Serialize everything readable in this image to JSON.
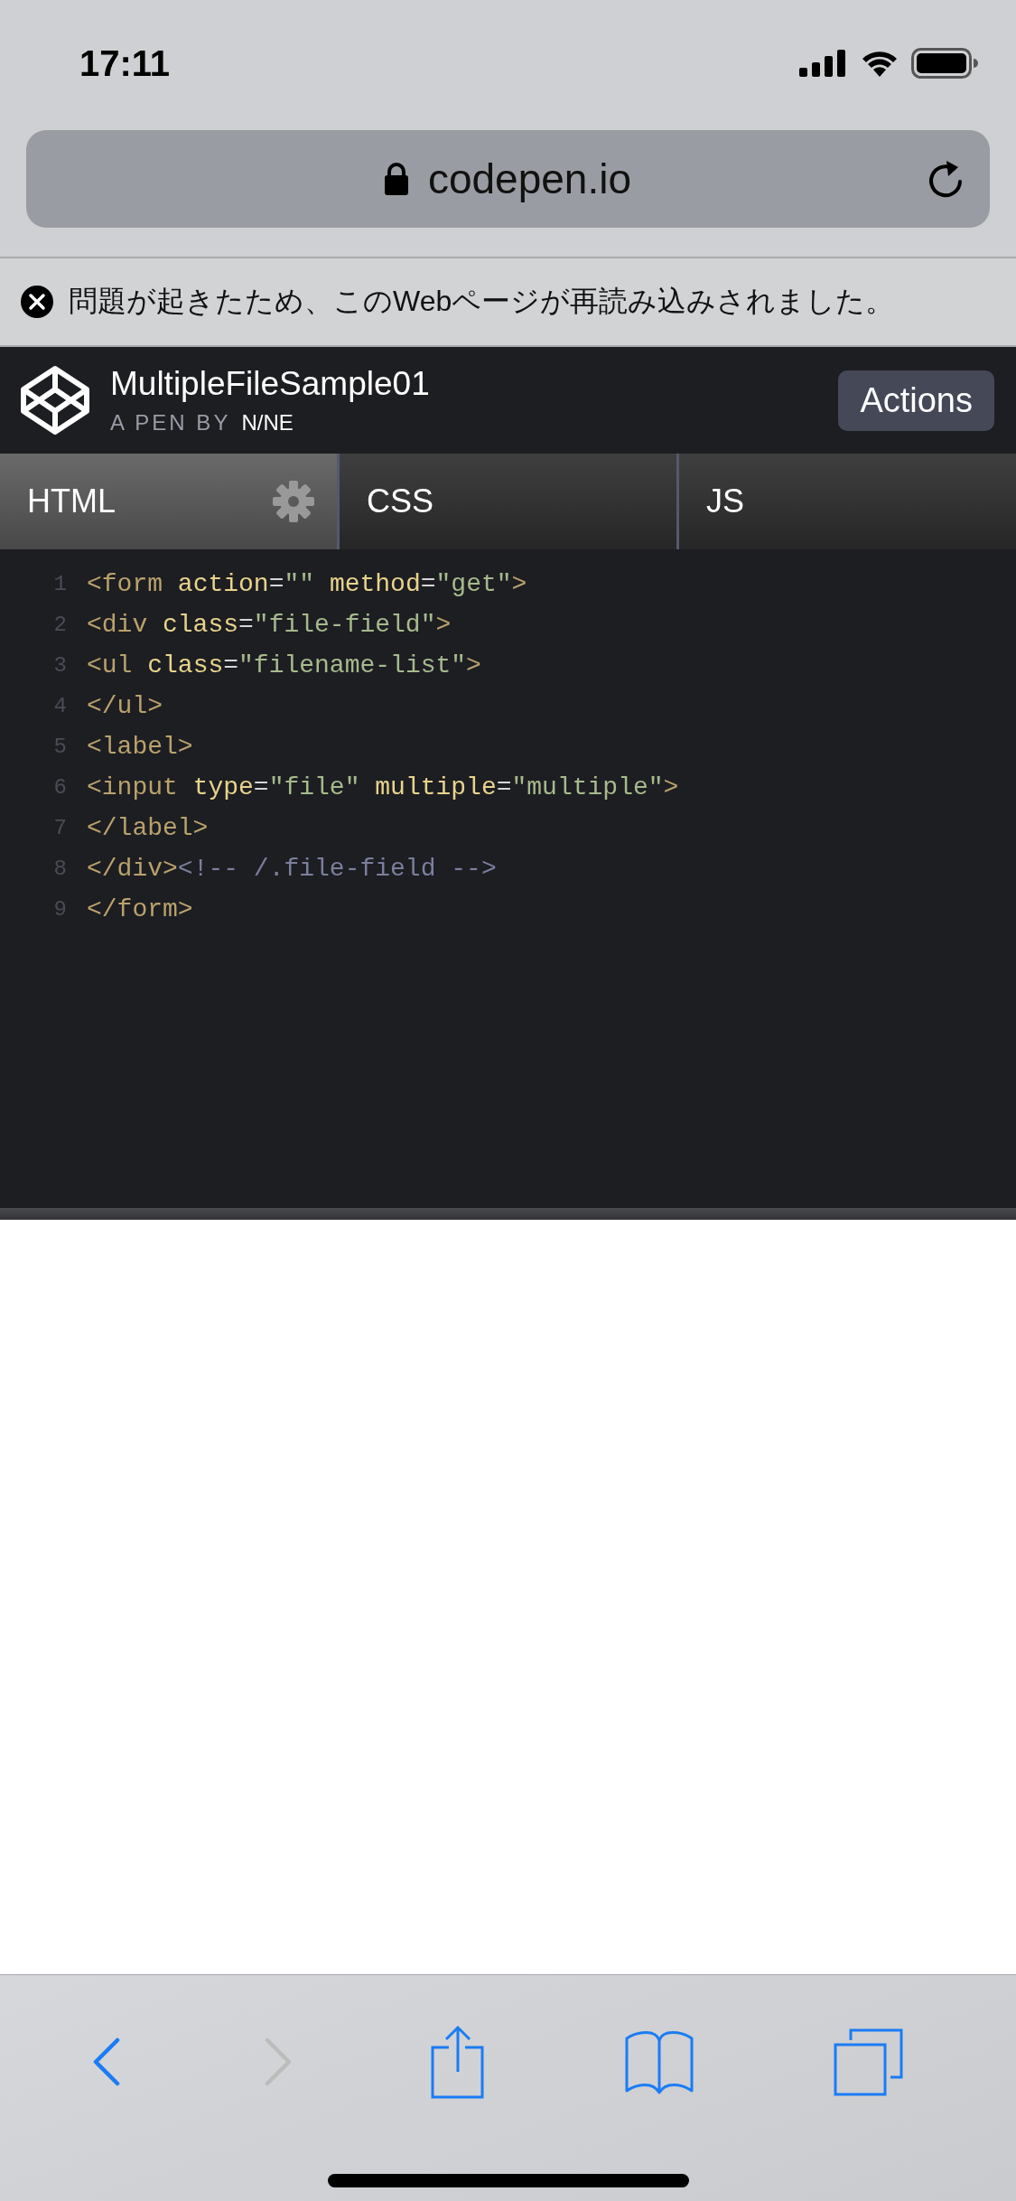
{
  "status_bar": {
    "time": "17:11"
  },
  "address_bar": {
    "url": "codepen.io"
  },
  "error_banner": {
    "message": "問題が起きたため、このWebページが再読み込みされました。"
  },
  "pen_header": {
    "title": "MultipleFileSample01",
    "byline": "A PEN BY",
    "author": "N/NE",
    "actions_button": "Actions"
  },
  "tabs": [
    {
      "label": "HTML",
      "selected": true,
      "has_settings": true
    },
    {
      "label": "CSS",
      "selected": false,
      "has_settings": false
    },
    {
      "label": "JS",
      "selected": false,
      "has_settings": false
    }
  ],
  "code_lines": [
    {
      "number": "1",
      "tokens": [
        {
          "kind": "tag",
          "text": "<form "
        },
        {
          "kind": "attr",
          "text": "action"
        },
        {
          "kind": "punct",
          "text": "="
        },
        {
          "kind": "string",
          "text": "\"\" "
        },
        {
          "kind": "attr",
          "text": "method"
        },
        {
          "kind": "punct",
          "text": "="
        },
        {
          "kind": "string",
          "text": "\"get\""
        },
        {
          "kind": "tag",
          "text": ">"
        }
      ]
    },
    {
      "number": "2",
      "tokens": [
        {
          "kind": "tag",
          "text": "<div "
        },
        {
          "kind": "attr",
          "text": "class"
        },
        {
          "kind": "punct",
          "text": "="
        },
        {
          "kind": "string",
          "text": "\"file-field\""
        },
        {
          "kind": "tag",
          "text": ">"
        }
      ]
    },
    {
      "number": "3",
      "tokens": [
        {
          "kind": "tag",
          "text": "<ul "
        },
        {
          "kind": "attr",
          "text": "class"
        },
        {
          "kind": "punct",
          "text": "="
        },
        {
          "kind": "string",
          "text": "\"filename-list\""
        },
        {
          "kind": "tag",
          "text": ">"
        }
      ]
    },
    {
      "number": "4",
      "tokens": [
        {
          "kind": "tag",
          "text": "</ul>"
        }
      ]
    },
    {
      "number": "5",
      "tokens": [
        {
          "kind": "tag",
          "text": "<label>"
        }
      ]
    },
    {
      "number": "6",
      "tokens": [
        {
          "kind": "tag",
          "text": "<input "
        },
        {
          "kind": "attr",
          "text": "type"
        },
        {
          "kind": "punct",
          "text": "="
        },
        {
          "kind": "string",
          "text": "\"file\" "
        },
        {
          "kind": "attr",
          "text": "multiple"
        },
        {
          "kind": "punct",
          "text": "="
        },
        {
          "kind": "string",
          "text": "\"multiple\""
        },
        {
          "kind": "tag",
          "text": ">"
        }
      ]
    },
    {
      "number": "7",
      "tokens": [
        {
          "kind": "tag",
          "text": "</label>"
        }
      ]
    },
    {
      "number": "8",
      "tokens": [
        {
          "kind": "tag",
          "text": "</div>"
        },
        {
          "kind": "comment",
          "text": "<!-- /.file-field -->"
        }
      ]
    },
    {
      "number": "9",
      "tokens": [
        {
          "kind": "tag",
          "text": "</form>"
        }
      ]
    }
  ],
  "toolbar": {
    "back_enabled": true,
    "forward_enabled": false
  }
}
